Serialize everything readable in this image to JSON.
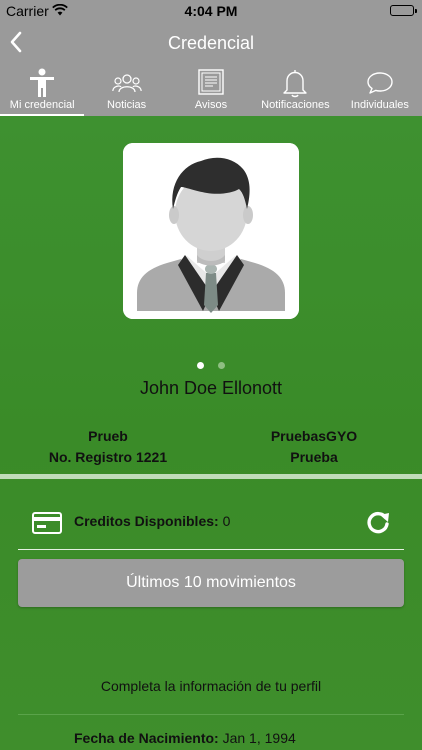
{
  "status_bar": {
    "carrier": "Carrier",
    "time": "4:04 PM"
  },
  "nav": {
    "title": "Credencial"
  },
  "tabs": [
    {
      "label": "Mi credencial",
      "icon": "person-icon",
      "active": true
    },
    {
      "label": "Noticias",
      "icon": "group-icon",
      "active": false
    },
    {
      "label": "Avisos",
      "icon": "document-icon",
      "active": false
    },
    {
      "label": "Notificaciones",
      "icon": "bell-icon",
      "active": false
    },
    {
      "label": "Individuales",
      "icon": "chat-bubble-icon",
      "active": false
    }
  ],
  "profile": {
    "name": "John Doe Ellonott",
    "left_line1": "Prueb",
    "left_line2": "No. Registro 1221",
    "right_line1": "PruebasGYO",
    "right_line2": "Prueba"
  },
  "credits": {
    "label": "Creditos Disponibles:",
    "value": "0"
  },
  "movements_button": "Últimos 10 movimientos",
  "complete_profile": "Completa la información de tu perfil",
  "birth": {
    "label": "Fecha de Nacimiento:",
    "value": "Jan 1, 1994"
  },
  "colors": {
    "bar": "#9a9a9a",
    "background": "#3d8f2c",
    "button": "#9c9c9c"
  }
}
